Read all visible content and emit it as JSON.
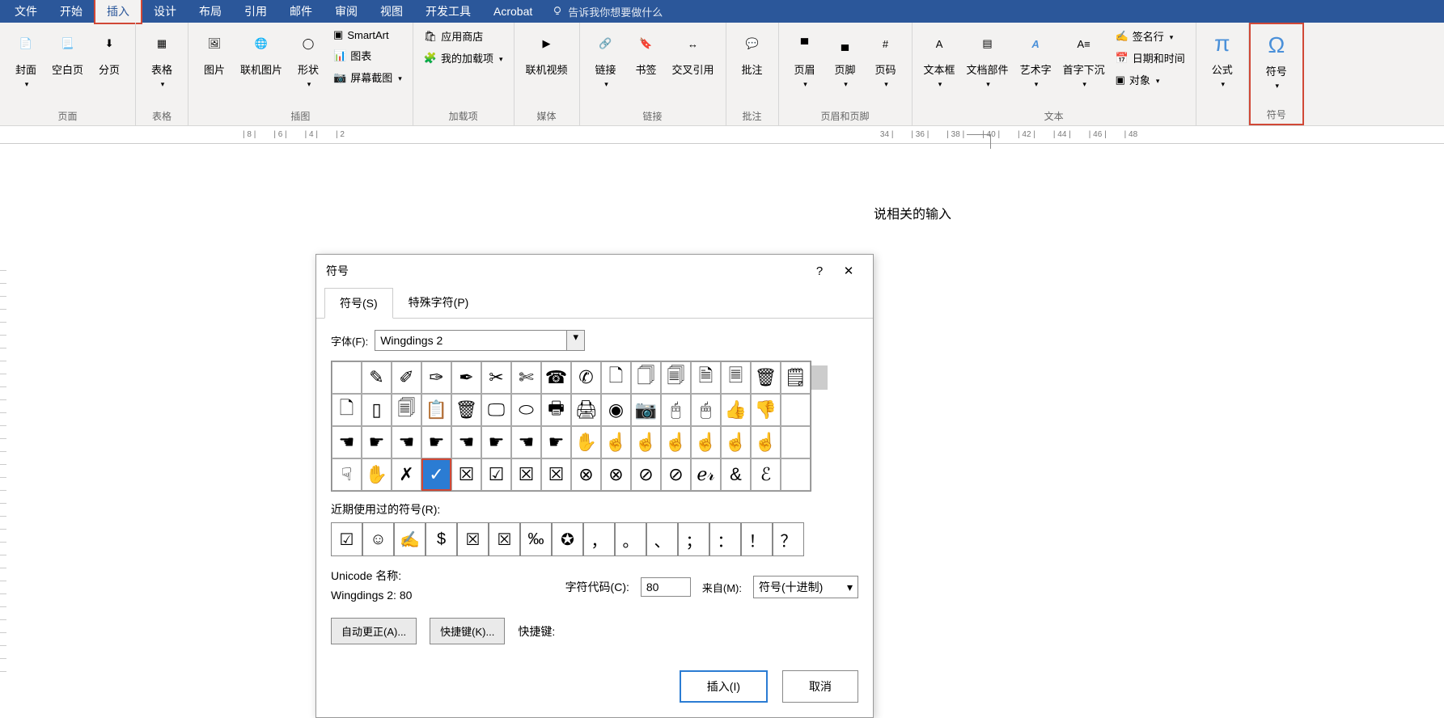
{
  "menubar": {
    "items": [
      "文件",
      "开始",
      "插入",
      "设计",
      "布局",
      "引用",
      "邮件",
      "审阅",
      "视图",
      "开发工具",
      "Acrobat"
    ],
    "active_index": 2,
    "tell_me": "告诉我你想要做什么"
  },
  "ribbon": {
    "groups": [
      {
        "label": "页面",
        "buttons": [
          "封面",
          "空白页",
          "分页"
        ]
      },
      {
        "label": "表格",
        "buttons": [
          "表格"
        ]
      },
      {
        "label": "插图",
        "buttons": [
          "图片",
          "联机图片",
          "形状"
        ],
        "small": [
          "SmartArt",
          "图表",
          "屏幕截图"
        ]
      },
      {
        "label": "加载项",
        "small": [
          "应用商店",
          "我的加载项"
        ]
      },
      {
        "label": "媒体",
        "buttons": [
          "联机视频"
        ]
      },
      {
        "label": "链接",
        "buttons": [
          "链接",
          "书签",
          "交叉引用"
        ]
      },
      {
        "label": "批注",
        "buttons": [
          "批注"
        ]
      },
      {
        "label": "页眉和页脚",
        "buttons": [
          "页眉",
          "页脚",
          "页码"
        ]
      },
      {
        "label": "文本",
        "buttons": [
          "文本框",
          "文档部件",
          "艺术字",
          "首字下沉"
        ],
        "small": [
          "签名行",
          "日期和时间",
          "对象"
        ]
      },
      {
        "label": "",
        "buttons": [
          "公式"
        ]
      },
      {
        "label": "符号",
        "buttons": [
          "符号"
        ]
      }
    ]
  },
  "ruler": [
    "| 8 |",
    "| 6 |",
    "| 4 |",
    "| 2",
    "34 |",
    "| 36 |",
    "| 38 |",
    "| 40 |",
    "| 42 |",
    "| 44 |",
    "| 46 |",
    "| 48"
  ],
  "document": {
    "text": "说相关的输入"
  },
  "dialog": {
    "title": "符号",
    "tabs": [
      "符号(S)",
      "特殊字符(P)"
    ],
    "active_tab": 0,
    "font_label": "字体(F):",
    "font_value": "Wingdings 2",
    "grid": [
      [
        " ",
        "✎",
        "✐",
        "✑",
        "✒",
        "✂",
        "✄",
        "☎",
        "✆",
        "🗋",
        "🗍",
        "🗐",
        "🗎",
        "🗏",
        "🗑",
        "🗒"
      ],
      [
        "🗋",
        "▯",
        "🗐",
        "📋",
        "🗑",
        "🖵",
        "⬭",
        "🖶",
        "🖨",
        "◉",
        "📷",
        "🖰",
        "🖱",
        "👍",
        "👎",
        " "
      ],
      [
        "☚",
        "☛",
        "☚",
        "☛",
        "☚",
        "☛",
        "☚",
        "☛",
        "✋",
        "☝",
        "☝",
        "☝",
        "☝",
        "☝",
        "☝",
        " "
      ],
      [
        "☟",
        "✋",
        "✗",
        "✓",
        "☒",
        "☑",
        "☒",
        "☒",
        "⊗",
        "⊗",
        "⊘",
        "⊘",
        "ℯ𝓇",
        "&",
        "ℰ",
        " "
      ]
    ],
    "selected": {
      "row": 3,
      "col": 3
    },
    "recent_label": "近期使用过的符号(R):",
    "recent": [
      "☑",
      "☺",
      "✍",
      "$",
      "☒",
      "☒",
      "‰",
      "✪",
      "，",
      "。",
      "、",
      "；",
      "：",
      "！",
      "？"
    ],
    "unicode_name_label": "Unicode 名称:",
    "unicode_name_value": "Wingdings 2: 80",
    "char_code_label": "字符代码(C):",
    "char_code_value": "80",
    "from_label": "来自(M):",
    "from_value": "符号(十进制)",
    "autocorrect_btn": "自动更正(A)...",
    "shortcut_btn": "快捷键(K)...",
    "shortcut_label": "快捷键:",
    "insert_btn": "插入(I)",
    "cancel_btn": "取消",
    "help_icon": "?",
    "close_icon": "✕"
  }
}
